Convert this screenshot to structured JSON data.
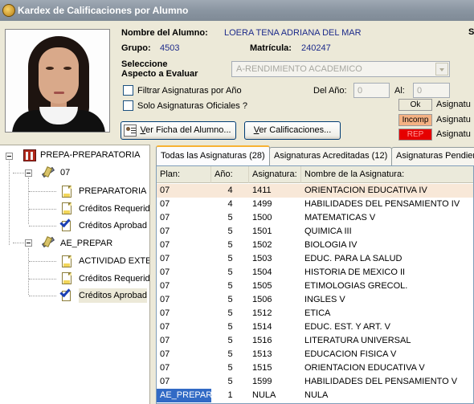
{
  "window": {
    "title": "Kardex de Calificaciones por Alumno"
  },
  "student": {
    "name_label": "Nombre del Alumno:",
    "name_value": "LOERA TENA ADRIANA DEL MAR",
    "group_label": "Grupo:",
    "group_value": "4503",
    "matricula_label": "Matrícula:",
    "matricula_value": "240247",
    "right_clip": "S"
  },
  "aspect": {
    "label_line1": "Seleccione",
    "label_line2": "Aspecto a Evaluar",
    "selected": "A-RENDIMIENTO ACADEMICO"
  },
  "filters": {
    "filter_by_year": "Filtrar Asignaturas por Año",
    "official_only": "Solo Asignaturas Oficiales ?",
    "del_ano_label": "Del Año:",
    "del_ano_value": "0",
    "al_label": "Al:",
    "al_value": "0"
  },
  "legend": [
    {
      "box": "Ok",
      "text": "Asignatu",
      "color": "#ece9d8",
      "text_color": "#000000"
    },
    {
      "box": "Incomp",
      "text": "Asignatu",
      "color": "#f4b183",
      "text_color": "#000000"
    },
    {
      "box": "REP",
      "text": "Asignatu",
      "color": "#e60000",
      "text_color": "#ff9a9a"
    }
  ],
  "buttons": {
    "ficha_prefix": "V",
    "ficha_rest": "er Ficha del Alumno...",
    "calif_prefix": "V",
    "calif_rest": "er Calificaciones..."
  },
  "tree": {
    "root": "PREPA-PREPARATORIA",
    "node1": "07",
    "node1_children": [
      "PREPARATORIA",
      "Créditos Requerid",
      "Créditos Aprobad"
    ],
    "node2": "AE_PREPAR",
    "node2_children": [
      "ACTIVIDAD EXTE",
      "Créditos Requerid",
      "Créditos Aprobad"
    ]
  },
  "tabs": [
    "Todas las Asignaturas (28)",
    "Asignaturas Acreditadas (12)",
    "Asignaturas Pendien"
  ],
  "grid": {
    "headers": [
      "Plan:",
      "Año:",
      "Asignatura:",
      "Nombre de la Asignatura:"
    ],
    "rows": [
      [
        "07",
        "4",
        "1411",
        "ORIENTACION EDUCATIVA IV"
      ],
      [
        "07",
        "4",
        "1499",
        "HABILIDADES DEL PENSAMIENTO IV"
      ],
      [
        "07",
        "5",
        "1500",
        "MATEMATICAS V"
      ],
      [
        "07",
        "5",
        "1501",
        "QUIMICA  III"
      ],
      [
        "07",
        "5",
        "1502",
        "BIOLOGIA IV"
      ],
      [
        "07",
        "5",
        "1503",
        "EDUC. PARA LA SALUD"
      ],
      [
        "07",
        "5",
        "1504",
        "HISTORIA DE MEXICO II"
      ],
      [
        "07",
        "5",
        "1505",
        "ETIMOLOGIAS GRECOL."
      ],
      [
        "07",
        "5",
        "1506",
        "INGLES V"
      ],
      [
        "07",
        "5",
        "1512",
        "ETICA"
      ],
      [
        "07",
        "5",
        "1514",
        "EDUC. EST. Y ART. V"
      ],
      [
        "07",
        "5",
        "1516",
        "LITERATURA  UNIVERSAL"
      ],
      [
        "07",
        "5",
        "1513",
        "EDUCACION FISICA V"
      ],
      [
        "07",
        "5",
        "1515",
        "ORIENTACION EDUCATIVA V"
      ],
      [
        "07",
        "5",
        "1599",
        "HABILIDADES DEL PENSAMIENTO V"
      ],
      [
        "AE_PREPAR",
        "1",
        "NULA",
        "NULA"
      ]
    ]
  }
}
